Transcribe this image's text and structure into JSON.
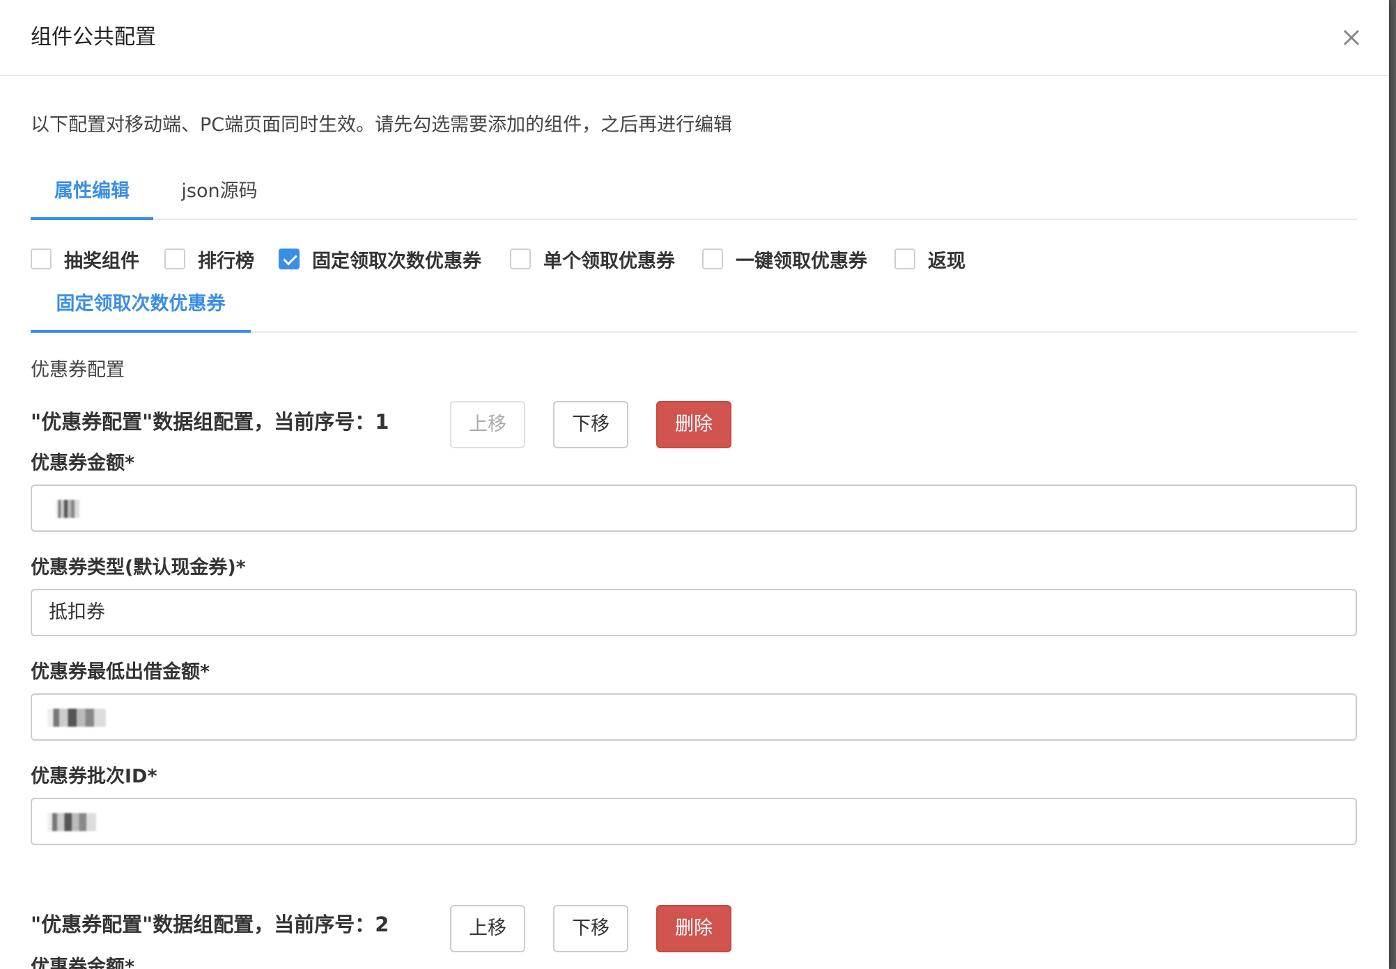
{
  "modal": {
    "title": "组件公共配置",
    "close_icon": "close-icon"
  },
  "intro": "以下配置对移动端、PC端页面同时生效。请先勾选需要添加的组件，之后再进行编辑",
  "tabs": [
    {
      "label": "属性编辑",
      "active": true
    },
    {
      "label": "json源码",
      "active": false
    }
  ],
  "components": [
    {
      "label": "抽奖组件",
      "checked": false
    },
    {
      "label": "排行榜",
      "checked": false
    },
    {
      "label": "固定领取次数优惠券",
      "checked": true
    },
    {
      "label": "单个领取优惠券",
      "checked": false
    },
    {
      "label": "一键领取优惠券",
      "checked": false
    },
    {
      "label": "返现",
      "checked": false
    }
  ],
  "subtabs": [
    {
      "label": "固定领取次数优惠券",
      "active": true
    }
  ],
  "section_label": "优惠券配置",
  "groups": [
    {
      "title": "\"优惠券配置\"数据组配置，当前序号：1",
      "buttons": {
        "up": "上移",
        "down": "下移",
        "delete": "删除"
      },
      "up_disabled": true,
      "fields": [
        {
          "label": "优惠券金额*",
          "value": ""
        },
        {
          "label": "优惠券类型(默认现金券)*",
          "value": "抵扣券"
        },
        {
          "label": "优惠券最低出借金额*",
          "value": ""
        },
        {
          "label": "优惠券批次ID*",
          "value": ""
        }
      ]
    },
    {
      "title": "\"优惠券配置\"数据组配置，当前序号：2",
      "buttons": {
        "up": "上移",
        "down": "下移",
        "delete": "删除"
      },
      "up_disabled": false,
      "fields": [
        {
          "label": "优惠券金额*",
          "value": ""
        }
      ]
    }
  ],
  "colors": {
    "accent": "#3a8ee6",
    "danger": "#d1544f",
    "border": "#cccccc"
  }
}
